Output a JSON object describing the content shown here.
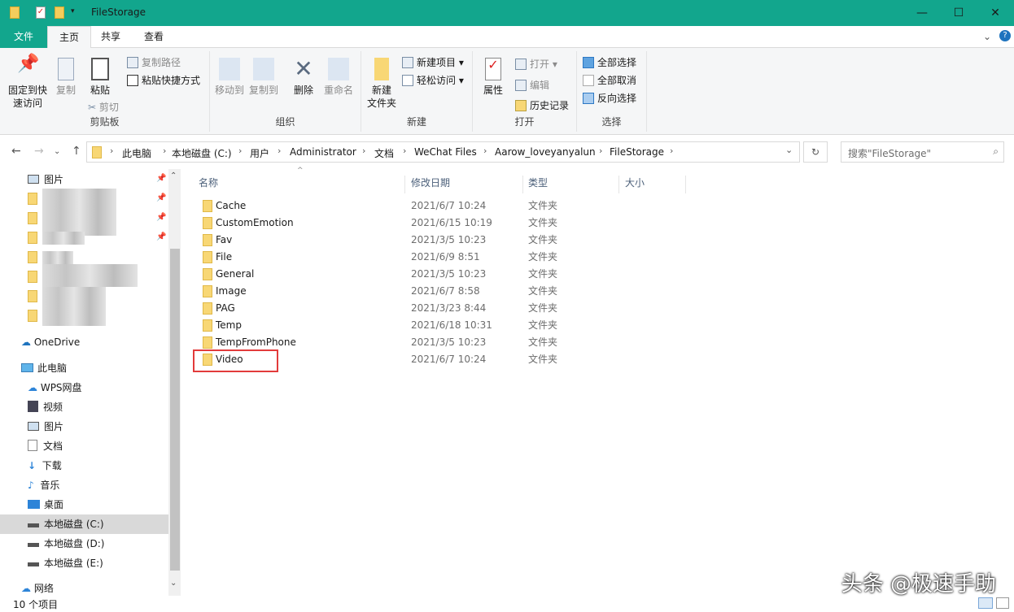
{
  "window": {
    "title": "FileStorage",
    "controls": [
      "—",
      "☐",
      "✕"
    ]
  },
  "tabs": [
    "文件",
    "主页",
    "共享",
    "查看"
  ],
  "ribbon": {
    "clipboard": {
      "label": "剪贴板",
      "pin": "固定到快\n速访问",
      "copy": "复制",
      "paste": "粘贴",
      "copy_path": "复制路径",
      "paste_shortcut": "粘贴快捷方式",
      "cut": "剪切"
    },
    "organize": {
      "label": "组织",
      "move_to": "移动到",
      "copy_to": "复制到",
      "delete": "删除",
      "rename": "重命名"
    },
    "new": {
      "label": "新建",
      "new_folder": "新建\n文件夹",
      "new_item": "新建项目",
      "easy_access": "轻松访问"
    },
    "open": {
      "label": "打开",
      "properties": "属性",
      "open": "打开",
      "edit": "编辑",
      "history": "历史记录"
    },
    "select": {
      "label": "选择",
      "select_all": "全部选择",
      "select_none": "全部取消",
      "invert": "反向选择"
    }
  },
  "address": {
    "crumbs": [
      "此电脑",
      "本地磁盘 (C:)",
      "用户",
      "Administrator",
      "文档",
      "WeChat Files",
      "Aarow_loveyanyalun",
      "FileStorage"
    ],
    "search_placeholder": "搜索\"FileStorage\""
  },
  "sidebar": {
    "pictures_quick": "图片",
    "onedrive": "OneDrive",
    "this_pc": "此电脑",
    "items": [
      "WPS网盘",
      "视频",
      "图片",
      "文档",
      "下载",
      "音乐",
      "桌面",
      "本地磁盘 (C:)",
      "本地磁盘 (D:)",
      "本地磁盘 (E:)"
    ],
    "network": "网络"
  },
  "columns": {
    "name": "名称",
    "date": "修改日期",
    "type": "类型",
    "size": "大小"
  },
  "files": [
    {
      "name": "Cache",
      "date": "2021/6/7 10:24",
      "type": "文件夹"
    },
    {
      "name": "CustomEmotion",
      "date": "2021/6/15 10:19",
      "type": "文件夹"
    },
    {
      "name": "Fav",
      "date": "2021/3/5 10:23",
      "type": "文件夹"
    },
    {
      "name": "File",
      "date": "2021/6/9 8:51",
      "type": "文件夹"
    },
    {
      "name": "General",
      "date": "2021/3/5 10:23",
      "type": "文件夹"
    },
    {
      "name": "Image",
      "date": "2021/6/7 8:58",
      "type": "文件夹"
    },
    {
      "name": "PAG",
      "date": "2021/3/23 8:44",
      "type": "文件夹"
    },
    {
      "name": "Temp",
      "date": "2021/6/18 10:31",
      "type": "文件夹"
    },
    {
      "name": "TempFromPhone",
      "date": "2021/3/5 10:23",
      "type": "文件夹"
    },
    {
      "name": "Video",
      "date": "2021/6/7 10:24",
      "type": "文件夹"
    }
  ],
  "status": "10 个项目",
  "watermark": "头条 @极速手助",
  "colors": {
    "title_bar": "#12a68d",
    "highlight": "#e23b3b"
  }
}
